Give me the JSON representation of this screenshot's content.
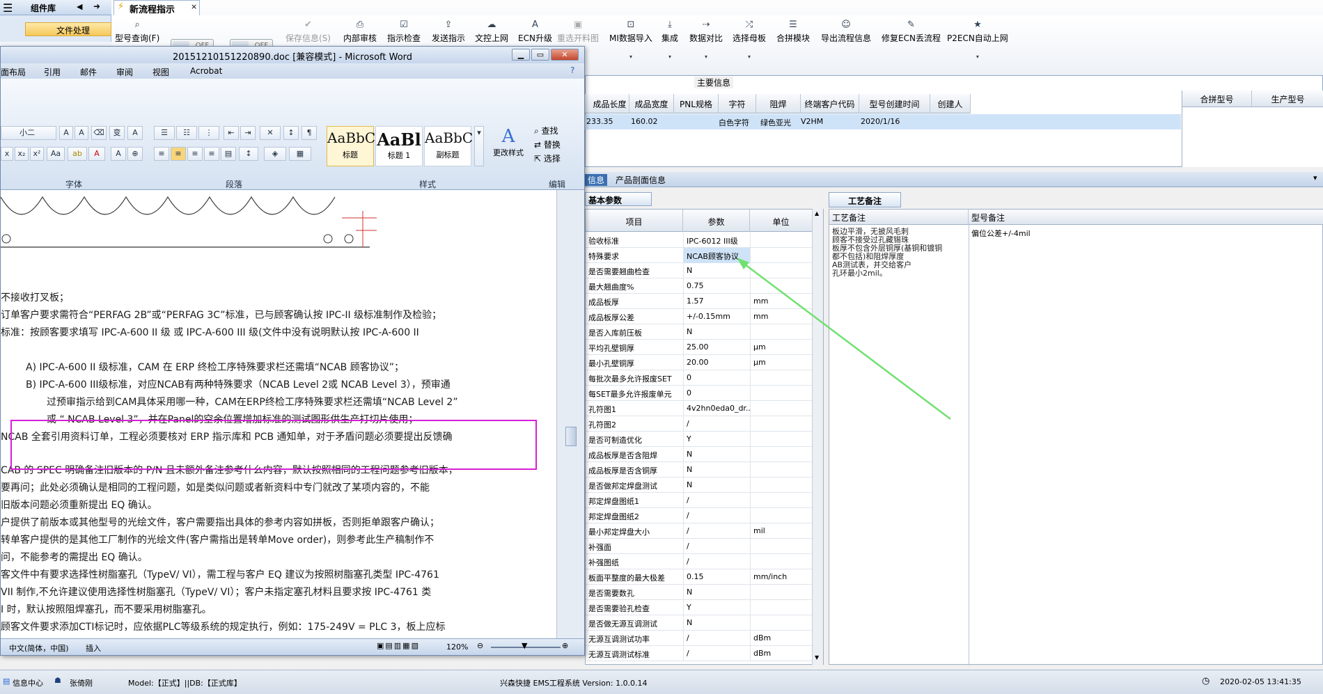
{
  "app": {
    "left_panel_title": "组件库",
    "left_panel_item": "文件处理",
    "doc_tab": "新流程指示",
    "toolbar": [
      {
        "label": "型号查询(F)",
        "icon": "search-icon"
      },
      {
        "label": "保存信息(S)",
        "icon": "save-icon",
        "disabled": true
      },
      {
        "label": "内部审核",
        "icon": "print-icon"
      },
      {
        "label": "指示检查",
        "icon": "check-icon"
      },
      {
        "label": "发送指示",
        "icon": "send-icon"
      },
      {
        "label": "文控上网",
        "icon": "upload-icon"
      },
      {
        "label": "ECN升级",
        "icon": "ecn-icon"
      },
      {
        "label": "重选开料图",
        "icon": "image-icon",
        "disabled": true
      },
      {
        "label": "MI数据导入",
        "icon": "import-icon"
      },
      {
        "label": "集成",
        "icon": "download-icon"
      },
      {
        "label": "数据对比",
        "icon": "compare-icon"
      },
      {
        "label": "选择母板",
        "icon": "shuffle-icon"
      },
      {
        "label": "合拼模块",
        "icon": "list-icon"
      },
      {
        "label": "导出流程信息",
        "icon": "smile-icon"
      },
      {
        "label": "修复ECN丢流程",
        "icon": "wrench-icon"
      },
      {
        "label": "P2ECN自动上网",
        "icon": "star-icon"
      }
    ],
    "toggle_off": "OFF",
    "main_info_title": "主要信息",
    "main_headers": [
      "成品长度",
      "成品宽度",
      "PNL规格",
      "字符",
      "阻焊",
      "终端客户代码",
      "型号创建时间",
      "创建人"
    ],
    "main_row": [
      "233.35",
      "160.02",
      "",
      "白色字符",
      "绿色亚光",
      "V2HM",
      "2020/1/16",
      ""
    ],
    "merge_headers": [
      "合拼型号",
      "生产型号"
    ],
    "lower_tab_1": "信息",
    "lower_tab_2": "产品剖面信息",
    "basic_tab": "基本参数",
    "param_headers": [
      "项目",
      "参数",
      "单位"
    ],
    "params": [
      [
        "验收标准",
        "IPC-6012 III级",
        ""
      ],
      [
        "特殊要求",
        "NCAB顾客协议",
        ""
      ],
      [
        "是否需要翘曲检查",
        "N",
        ""
      ],
      [
        "最大翘曲度%",
        "0.75",
        ""
      ],
      [
        "成品板厚",
        "1.57",
        "mm"
      ],
      [
        "成品板厚公差",
        "+/-0.15mm",
        "mm"
      ],
      [
        "是否入库前压板",
        "N",
        ""
      ],
      [
        "平均孔壁铜厚",
        "25.00",
        "μm"
      ],
      [
        "最小孔壁铜厚",
        "20.00",
        "μm"
      ],
      [
        "每批次最多允许报废SET",
        "0",
        ""
      ],
      [
        "每SET最多允许报废单元",
        "0",
        ""
      ],
      [
        "孔符图1",
        "4v2hn0eda0_dr...",
        ""
      ],
      [
        "孔符图2",
        "/",
        ""
      ],
      [
        "是否可制造优化",
        "Y",
        ""
      ],
      [
        "成品板厚是否含阻焊",
        "N",
        ""
      ],
      [
        "成品板厚是否含铜厚",
        "N",
        ""
      ],
      [
        "是否做邦定焊盘测试",
        "N",
        ""
      ],
      [
        "邦定焊盘图纸1",
        "/",
        ""
      ],
      [
        "邦定焊盘图纸2",
        "/",
        ""
      ],
      [
        "最小邦定焊盘大小",
        "/",
        "mil"
      ],
      [
        "补强面",
        "/",
        ""
      ],
      [
        "补强图纸",
        "/",
        ""
      ],
      [
        "板面平整度的最大极差",
        "0.15",
        "mm/inch"
      ],
      [
        "是否需要数孔",
        "N",
        ""
      ],
      [
        "是否需要验孔检查",
        "Y",
        ""
      ],
      [
        "是否做无源互调测试",
        "N",
        ""
      ],
      [
        "无源互调测试功率",
        "/",
        "dBm"
      ],
      [
        "无源互调测试标准",
        "/",
        "dBm"
      ]
    ],
    "craft_tab": "工艺备注",
    "craft_headers": [
      "工艺备注",
      "型号备注"
    ],
    "craft_note": [
      "板边平滑，无披风毛刺",
      "顾客不接受过孔藏锡珠",
      "板厚不包含外层铜厚(基铜和镀铜",
      "都不包括)和阻焊厚度",
      "AB测试表，并交给客户",
      "孔环最小2mil。"
    ],
    "model_note": "偏位公差+/-4mil",
    "status": {
      "info_center": "信息中心",
      "user": "张倚刚",
      "model_db": "Model:【正式】||DB:【正式库】",
      "system": "兴森快捷 EMS工程系统 Version: 1.0.0.14",
      "datetime": "2020-02-05 13:41:35"
    }
  },
  "word": {
    "title": "20151210151220890.doc [兼容模式] - Microsoft Word",
    "menu": [
      "面布局",
      "引用",
      "邮件",
      "审阅",
      "视图",
      "Acrobat"
    ],
    "font_size": "小二",
    "groups": [
      "字体",
      "段落",
      "样式",
      "编辑"
    ],
    "styles": [
      {
        "preview": "AaBbC",
        "name": "标题"
      },
      {
        "preview": "AaBl",
        "name": "标题 1"
      },
      {
        "preview": "AaBbC",
        "name": "副标题"
      }
    ],
    "change_styles": "更改样式",
    "edit_items": [
      "查找",
      "替换",
      "选择"
    ],
    "lines": [
      "不接收打叉板；",
      "订单客户要求需符合“PERFAG 2B”或“PERFAG 3C”标准，已与顾客确认按 IPC-II 级标准制作及检验；",
      "标准：按顾客要求填写 IPC-A-600 II 级 或 IPC-A-600 III 级(文件中没有说明默认按 IPC-A-600 II",
      "A)  IPC-A-600 II 级标准，CAM 在 ERP 终检工序特殊要求栏还需填“NCAB 顾客协议”；",
      "B)  IPC-A-600 III级标准，对应NCAB有两种特殊要求（NCAB Level 2或 NCAB Level 3），预审通",
      "过预审指示给到CAM具体采用哪一种，CAM在ERP终检工序特殊要求栏还需填“NCAB Level 2”",
      "或 “ NCAB Level 3”，并在Panel的空余位置增加标准的测试图形供生产打切片使用；",
      "NCAB 全套引用资料订单，工程必须要核对 ERP 指示库和 PCB 通知单，对于矛盾问题必须要提出反馈确",
      "CAB 的 SPEC 明确备注旧版本的 P/N 且未额外备注参考什么内容，默认按照相同的工程问题参考旧版本，",
      "要再问；此处必须确认是相同的工程问题，如是类似问题或者新资料中专门就改了某项内容的，不能",
      "旧版本问题必须重新提出 EQ 确认。",
      "户提供了前版本或其他型号的光绘文件，客户需要指出具体的参考内容如拼板，否则拒单跟客户确认；",
      "转单客户提供的是其他工厂制作的光绘文件(客户需指出是转单Move order)，则参考此生产稿制作不",
      "问，不能参考的需提出 EQ 确认。",
      "客文件中有要求选择性树脂塞孔（TypeV/ VI），需工程与客户 EQ 建议为按照树脂塞孔类型 IPC-4761",
      "VII 制作,不允许建议使用选择性树脂塞孔（TypeV/ VI）；客户未指定塞孔材料且要求按 IPC-4761 类",
      "I 时，默认按照阻焊塞孔，而不要采用树脂塞孔。",
      "顾客文件要求添加CTI标记时，应依据PLC等级系统的规定执行，例如：175-249V = PLC 3，板上应标"
    ],
    "status_lang": "中文(简体，中国)",
    "status_mode": "插入",
    "zoom": "120%"
  }
}
